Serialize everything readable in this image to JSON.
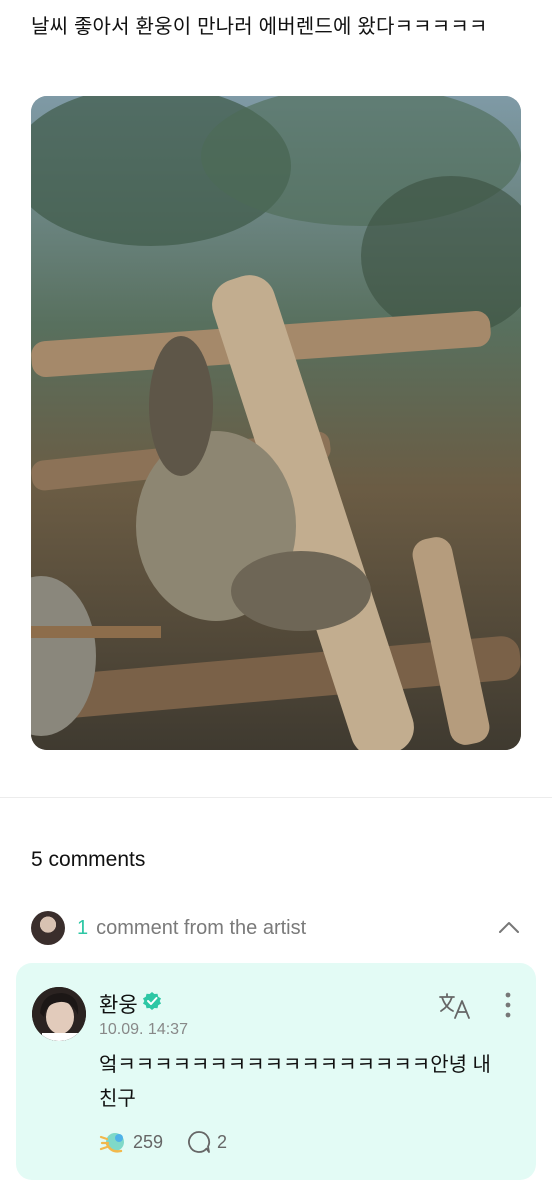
{
  "post": {
    "text": "날씨 좋아서 환웅이 만나러 에버렌드에 왔다ㅋㅋㅋㅋㅋ"
  },
  "comments": {
    "count_label": "5 comments",
    "artist_summary": {
      "count": "1",
      "label": "comment from the artist",
      "toggle_icon": "chevron-up-icon"
    },
    "artist_comment": {
      "author": "환웅",
      "verified_icon": "verified-badge-icon",
      "timestamp": "10.09. 14:37",
      "body": "엌ㅋㅋㅋㅋㅋㅋㅋㅋㅋㅋㅋㅋㅋㅋㅋㅋㅋ안녕 내 친구",
      "reactions": "259",
      "replies": "2",
      "translate_icon": "translate-icon",
      "more_icon": "more-vertical-icon"
    }
  },
  "colors": {
    "accent": "#2ec7a5",
    "card_background": "#e3fbf5",
    "verified": "#2ec7a5"
  }
}
